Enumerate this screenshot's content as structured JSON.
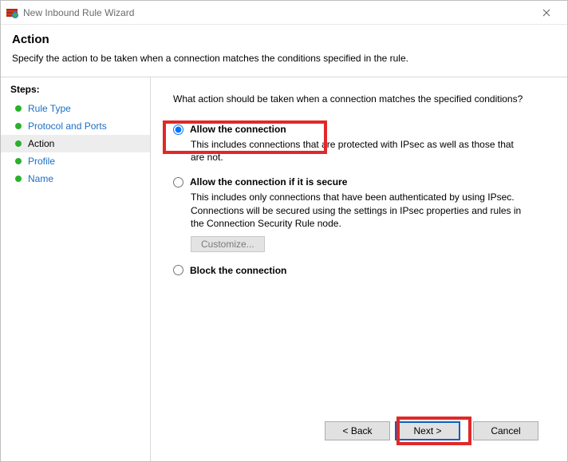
{
  "window": {
    "title": "New Inbound Rule Wizard"
  },
  "header": {
    "title": "Action",
    "subtitle": "Specify the action to be taken when a connection matches the conditions specified in the rule."
  },
  "sidebar": {
    "title": "Steps:",
    "items": [
      {
        "label": "Rule Type",
        "active": false
      },
      {
        "label": "Protocol and Ports",
        "active": false
      },
      {
        "label": "Action",
        "active": true
      },
      {
        "label": "Profile",
        "active": false
      },
      {
        "label": "Name",
        "active": false
      }
    ]
  },
  "content": {
    "prompt": "What action should be taken when a connection matches the specified conditions?",
    "options": {
      "allow": {
        "title": "Allow the connection",
        "desc": "This includes connections that are protected with IPsec as well as those that are not."
      },
      "allow_secure": {
        "title": "Allow the connection if it is secure",
        "desc": "This includes only connections that have been authenticated by using IPsec.  Connections will be secured using the settings in IPsec properties and rules in the Connection Security Rule node.",
        "customize": "Customize..."
      },
      "block": {
        "title": "Block the connection"
      }
    }
  },
  "footer": {
    "back": "< Back",
    "next": "Next >",
    "cancel": "Cancel"
  }
}
